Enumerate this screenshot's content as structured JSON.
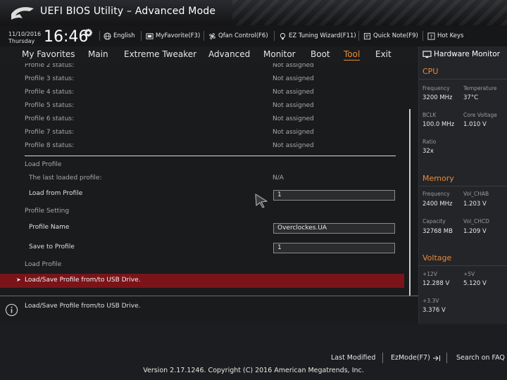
{
  "app": {
    "title": "UEFI BIOS Utility – Advanced Mode"
  },
  "infobar": {
    "date": "11/10/2016",
    "day": "Thursday",
    "time": "16:46",
    "items": [
      {
        "label": "English",
        "icon": "globe-icon"
      },
      {
        "label": "MyFavorite(F3)",
        "icon": "favorite-icon"
      },
      {
        "label": "Qfan Control(F6)",
        "icon": "fan-icon"
      },
      {
        "label": "EZ Tuning Wizard(F11)",
        "icon": "bulb-icon"
      },
      {
        "label": "Quick Note(F9)",
        "icon": "note-icon"
      },
      {
        "label": "Hot Keys",
        "icon": "help-icon"
      }
    ]
  },
  "menu": {
    "items": [
      "My Favorites",
      "Main",
      "Extreme Tweaker",
      "Advanced",
      "Monitor",
      "Boot",
      "Tool",
      "Exit"
    ],
    "active": "Tool"
  },
  "main": {
    "profile_status": [
      {
        "label": "Profile 2 status:",
        "value": "Not assigned"
      },
      {
        "label": "Profile 3 status:",
        "value": "Not assigned"
      },
      {
        "label": "Profile 4 status:",
        "value": "Not assigned"
      },
      {
        "label": "Profile 5 status:",
        "value": "Not assigned"
      },
      {
        "label": "Profile 6 status:",
        "value": "Not assigned"
      },
      {
        "label": "Profile 7 status:",
        "value": "Not assigned"
      },
      {
        "label": "Profile 8 status:",
        "value": "Not assigned"
      }
    ],
    "load_profile_header": "Load Profile",
    "last_loaded_label": "The last loaded profile:",
    "last_loaded_value": "N/A",
    "load_from_label": "Load from Profile",
    "load_from_value": "1",
    "profile_setting_header": "Profile Setting",
    "profile_name_label": "Profile Name",
    "profile_name_value": "Overclockes.UA",
    "save_to_label": "Save to Profile",
    "save_to_value": "1",
    "load_profile_header2": "Load Profile",
    "usb_item": "Load/Save Profile from/to USB Drive."
  },
  "help": {
    "text": "Load/Save Profile from/to USB Drive."
  },
  "hwmon": {
    "title": "Hardware Monitor",
    "cpu": {
      "title": "CPU",
      "frequency_label": "Frequency",
      "frequency": "3200 MHz",
      "temperature_label": "Temperature",
      "temperature": "37°C",
      "bclk_label": "BCLK",
      "bclk": "100.0 MHz",
      "core_voltage_label": "Core Voltage",
      "core_voltage": "1.010 V",
      "ratio_label": "Ratio",
      "ratio": "32x"
    },
    "memory": {
      "title": "Memory",
      "frequency_label": "Frequency",
      "frequency": "2400 MHz",
      "vol_chab_label": "Vol_CHAB",
      "vol_chab": "1.203 V",
      "capacity_label": "Capacity",
      "capacity": "32768 MB",
      "vol_chcd_label": "Vol_CHCD",
      "vol_chcd": "1.209 V"
    },
    "voltage": {
      "title": "Voltage",
      "v12_label": "+12V",
      "v12": "12.288 V",
      "v5_label": "+5V",
      "v5": "5.120 V",
      "v33_label": "+3.3V",
      "v33": "3.376 V"
    }
  },
  "footer": {
    "last_modified": "Last Modified",
    "ezmode": "EzMode(F7)",
    "search": "Search on FAQ",
    "copyright": "Version 2.17.1246. Copyright (C) 2016 American Megatrends, Inc."
  },
  "colors": {
    "accent": "#e98b3a",
    "selected": "#7a1419",
    "background": "#1a1b1d"
  }
}
